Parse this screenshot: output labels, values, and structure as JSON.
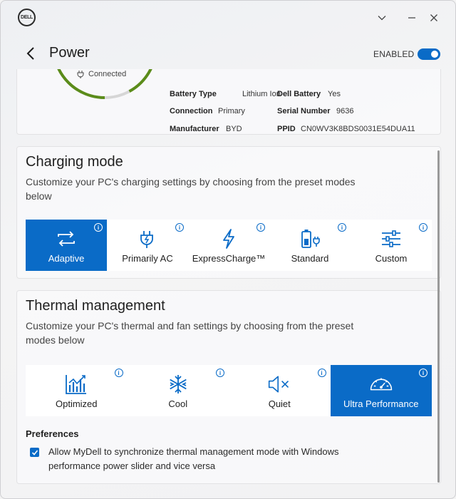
{
  "app": {
    "logo_text": "DELL"
  },
  "header": {
    "title": "Power",
    "enabled_label": "ENABLED",
    "enabled": true
  },
  "battery": {
    "status": "Connected",
    "charge_fraction": 0.92,
    "fields": [
      {
        "label": "Battery Type",
        "value": "Lithium Ion"
      },
      {
        "label": "Dell Battery",
        "value": "Yes"
      },
      {
        "label": "Connection",
        "value": "Primary"
      },
      {
        "label": "Serial Number",
        "value": "9636"
      },
      {
        "label": "Manufacturer",
        "value": "BYD"
      },
      {
        "label": "PPID",
        "value": "CN0WV3K8BDS0031E54DUA11"
      }
    ]
  },
  "charging": {
    "title": "Charging mode",
    "description": "Customize your PC's charging settings by choosing from the preset modes below",
    "modes": [
      {
        "label": "Adaptive",
        "icon": "adaptive-icon",
        "selected": true
      },
      {
        "label": "Primarily AC",
        "icon": "plug-icon",
        "selected": false
      },
      {
        "label": "ExpressCharge™",
        "icon": "lightning-icon",
        "selected": false
      },
      {
        "label": "Standard",
        "icon": "battery-plug-icon",
        "selected": false
      },
      {
        "label": "Custom",
        "icon": "sliders-icon",
        "selected": false
      }
    ]
  },
  "thermal": {
    "title": "Thermal management",
    "description": "Customize your PC's thermal and fan settings by choosing from the preset modes below",
    "modes": [
      {
        "label": "Optimized",
        "icon": "bar-chart-icon",
        "selected": false
      },
      {
        "label": "Cool",
        "icon": "snowflake-icon",
        "selected": false
      },
      {
        "label": "Quiet",
        "icon": "speaker-mute-icon",
        "selected": false
      },
      {
        "label": "Ultra Performance",
        "icon": "speedometer-icon",
        "selected": true
      }
    ],
    "preferences_title": "Preferences",
    "sync_checked": true,
    "sync_label": "Allow MyDell to synchronize thermal management mode with Windows performance power slider and vice versa"
  },
  "colors": {
    "accent": "#0a6bc7",
    "gauge": "#5b8c1a"
  }
}
